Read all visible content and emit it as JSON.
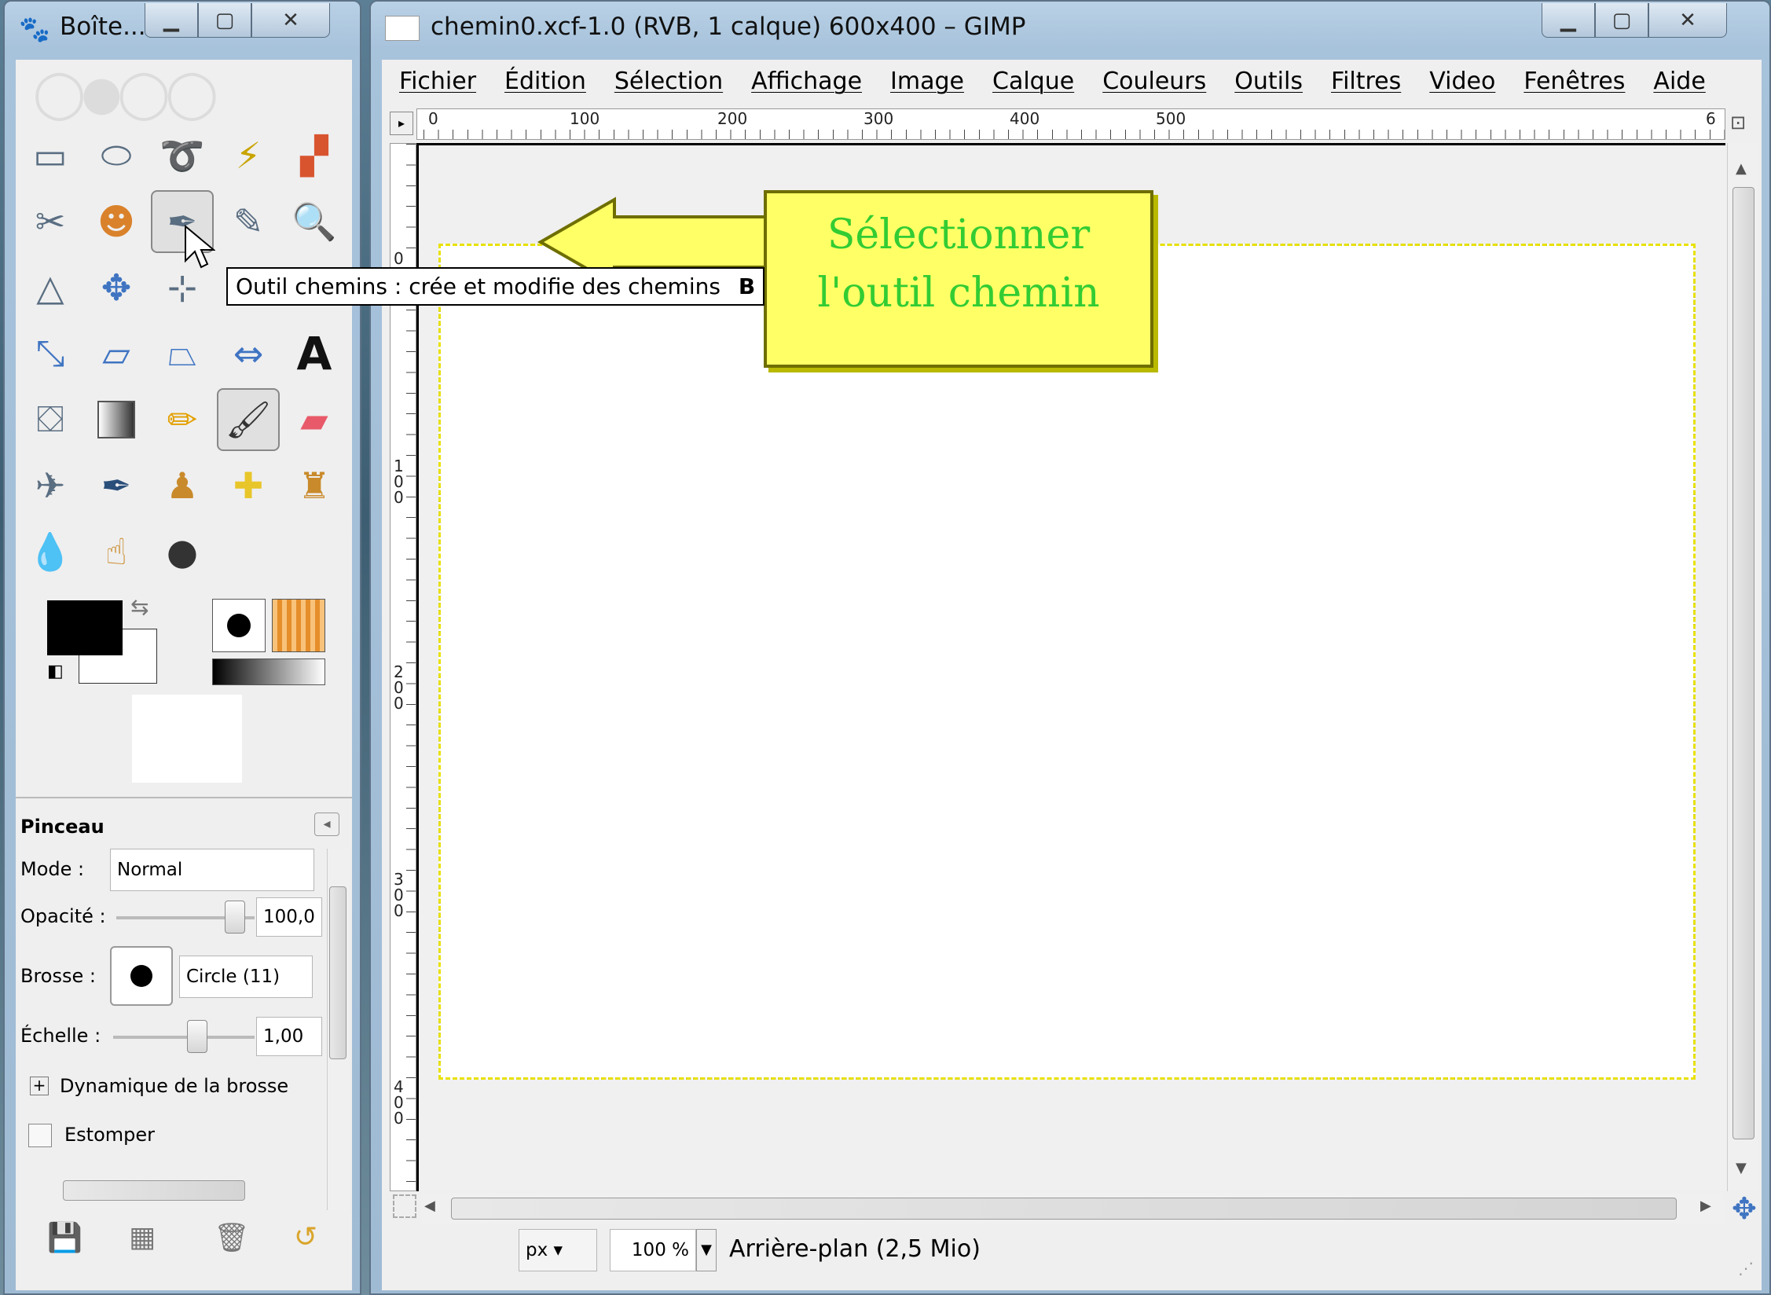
{
  "toolbox": {
    "title": "Boîte...",
    "options_title": "Pinceau",
    "mode_label": "Mode :",
    "mode_value": "Normal",
    "opacity_label": "Opacité :",
    "opacity_value": "100,0",
    "opacity_fraction": 1.0,
    "brush_label": "Brosse :",
    "brush_value": "Circle (11)",
    "scale_label": "Échelle :",
    "scale_value": "1,00",
    "dynamics_label": "Dynamique de la brosse",
    "blur_label": "Estomper"
  },
  "image_window": {
    "title": "chemin0.xcf-1.0 (RVB, 1 calque) 600x400 – GIMP",
    "menu": [
      "Fichier",
      "Édition",
      "Sélection",
      "Affichage",
      "Image",
      "Calque",
      "Couleurs",
      "Outils",
      "Filtres",
      "Video",
      "Fenêtres",
      "Aide"
    ],
    "ruler_h": [
      "0",
      "100",
      "200",
      "300",
      "400",
      "500",
      "6"
    ],
    "ruler_v": [
      "0",
      "100",
      "200",
      "300",
      "400"
    ],
    "unit": "px",
    "zoom": "100 %",
    "status": "Arrière-plan (2,5 Mio)"
  },
  "tooltip": {
    "text": "Outil chemins : crée et modifie des chemins",
    "shortcut": "B"
  },
  "callout": {
    "line1": "Sélectionner",
    "line2": "l'outil chemin"
  },
  "colors": {
    "callout_bg": "#ffff66",
    "callout_text": "#33cc33",
    "selection": "#e9e200"
  }
}
